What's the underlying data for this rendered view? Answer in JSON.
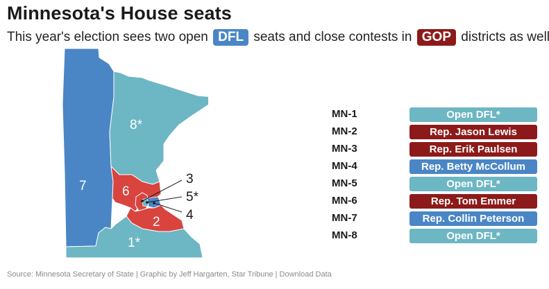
{
  "header": {
    "title": "Minnesota's House seats",
    "subtitle_before": "This year's election sees two open",
    "subtitle_tag1": "DFL",
    "subtitle_middle": "seats and close contests in",
    "subtitle_tag2": "GOP",
    "subtitle_after": "districts as well."
  },
  "colors": {
    "dfl_incumbent": "#4a86c5",
    "dfl_open": "#6db6c4",
    "gop": "#8d1a1a",
    "gop_map": "#d9443f"
  },
  "map": {
    "district_labels": {
      "d1": "1*",
      "d2": "2",
      "d6": "6",
      "d7": "7",
      "d8": "8*"
    },
    "callouts": {
      "d3": "3",
      "d4": "4",
      "d5": "5*"
    }
  },
  "districts": [
    {
      "code": "MN-1",
      "label": "Open DFL*",
      "status": "open_dfl"
    },
    {
      "code": "MN-2",
      "label": "Rep. Jason Lewis",
      "status": "gop"
    },
    {
      "code": "MN-3",
      "label": "Rep. Erik Paulsen",
      "status": "gop"
    },
    {
      "code": "MN-4",
      "label": "Rep. Betty McCollum",
      "status": "dfl"
    },
    {
      "code": "MN-5",
      "label": "Open DFL*",
      "status": "open_dfl"
    },
    {
      "code": "MN-6",
      "label": "Rep. Tom Emmer",
      "status": "gop"
    },
    {
      "code": "MN-7",
      "label": "Rep. Collin Peterson",
      "status": "dfl"
    },
    {
      "code": "MN-8",
      "label": "Open DFL*",
      "status": "open_dfl"
    }
  ],
  "footer": {
    "source": "Source: Minnesota Secretary of State | Graphic by Jeff Hargarten, Star Tribune | Download Data"
  }
}
